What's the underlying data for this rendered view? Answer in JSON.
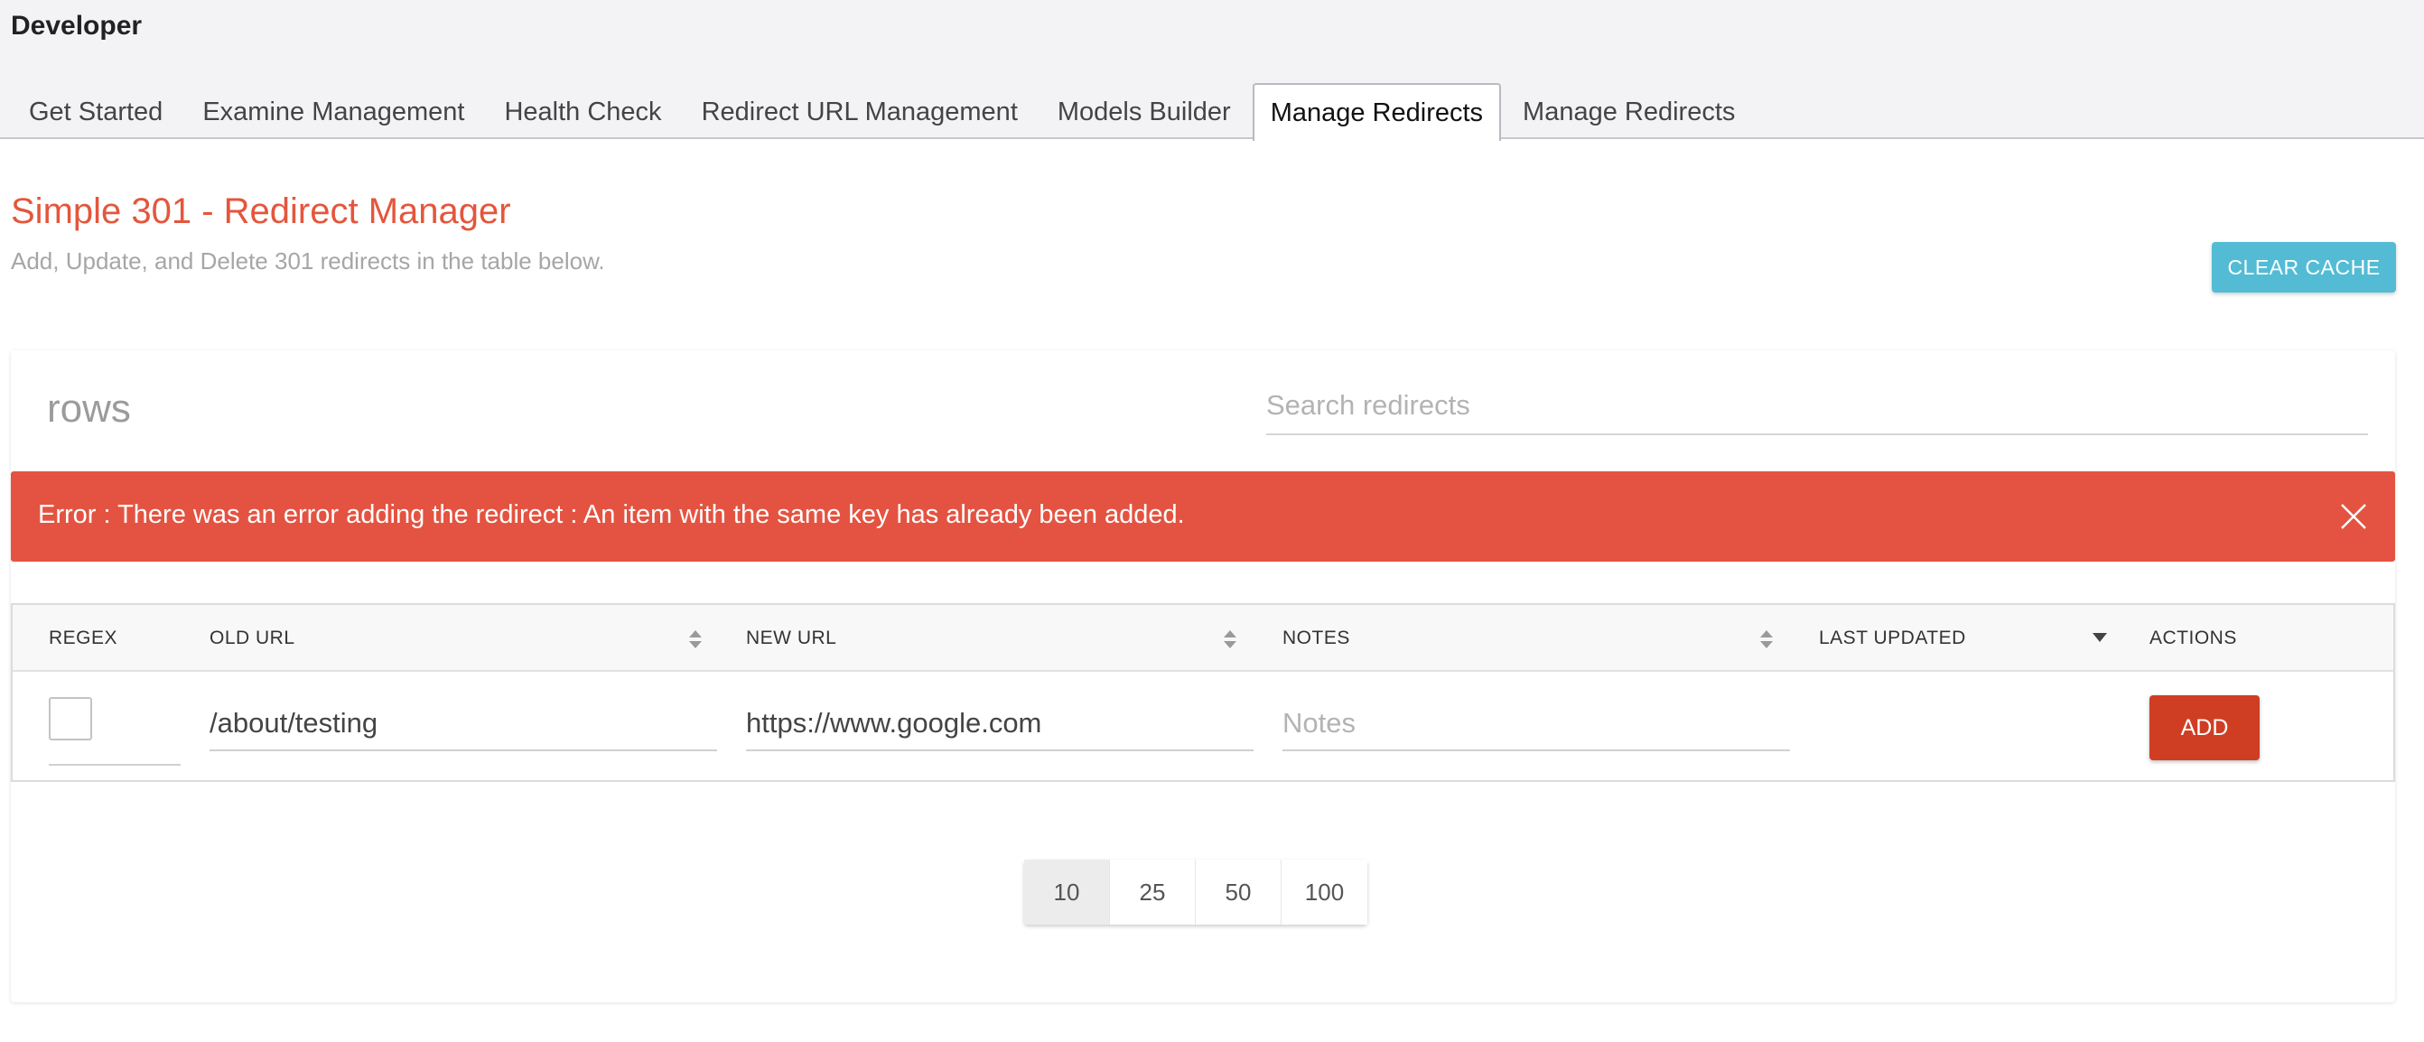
{
  "app": {
    "title": "Developer"
  },
  "tabs": [
    {
      "label": "Get Started",
      "active": false
    },
    {
      "label": "Examine Management",
      "active": false
    },
    {
      "label": "Health Check",
      "active": false
    },
    {
      "label": "Redirect URL Management",
      "active": false
    },
    {
      "label": "Models Builder",
      "active": false
    },
    {
      "label": "Manage Redirects",
      "active": true
    },
    {
      "label": "Manage Redirects",
      "active": false
    }
  ],
  "page": {
    "title": "Simple 301 - Redirect Manager",
    "subtitle": "Add, Update, and Delete 301 redirects in the table below.",
    "clear_cache_label": "CLEAR CACHE"
  },
  "list": {
    "rows_label": "rows",
    "search_placeholder": "Search redirects"
  },
  "error": {
    "message": "Error : There was an error adding the redirect : An item with the same key has already been added."
  },
  "table": {
    "headers": {
      "regex": "REGEX",
      "old_url": "OLD URL",
      "new_url": "NEW URL",
      "notes": "NOTES",
      "last_updated": "LAST UPDATED",
      "actions": "ACTIONS"
    },
    "new_row": {
      "regex_checked": false,
      "old_url": "/about/testing",
      "new_url": "https://www.google.com",
      "notes_placeholder": "Notes",
      "add_label": "ADD"
    }
  },
  "pagination": {
    "sizes": [
      "10",
      "25",
      "50",
      "100"
    ],
    "selected": "10"
  },
  "colors": {
    "accent_title": "#e4563c",
    "error_bg": "#e45341",
    "clear_cache_bg": "#53bcd4",
    "add_bg": "#cf3e23"
  }
}
